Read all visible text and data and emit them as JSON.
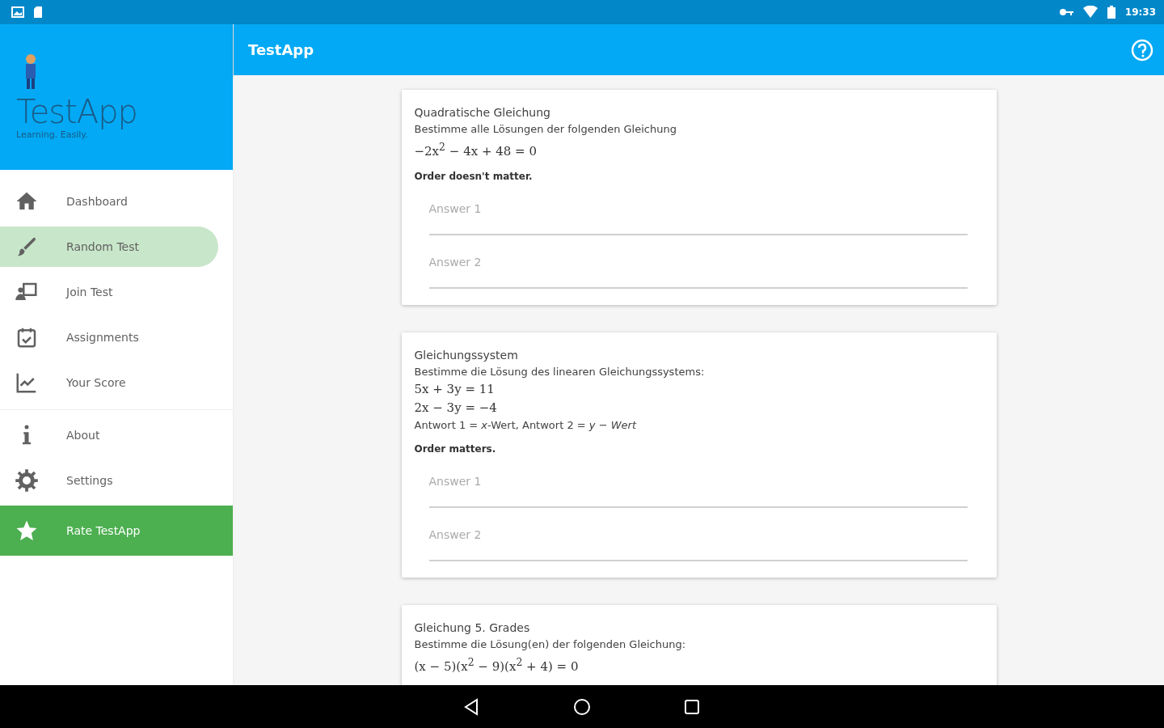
{
  "status_bar": {
    "time": "19:33"
  },
  "drawer": {
    "app_name": "TestApp",
    "tagline": "Learning. Easily.",
    "sections": [
      [
        {
          "label": "Dashboard",
          "kind": "nav",
          "selected": false
        },
        {
          "label": "Random Test",
          "kind": "nav",
          "selected": true
        },
        {
          "label": "Join Test",
          "kind": "nav",
          "selected": false
        },
        {
          "label": "Assignments",
          "kind": "nav",
          "selected": false
        },
        {
          "label": "Your Score",
          "kind": "nav",
          "selected": false
        }
      ],
      [
        {
          "label": "About",
          "kind": "nav",
          "selected": false
        },
        {
          "label": "Settings",
          "kind": "nav",
          "selected": false
        },
        {
          "label": "Rate TestApp",
          "kind": "action",
          "selected": false
        }
      ]
    ]
  },
  "app_bar": {
    "title": "TestApp"
  },
  "cards": [
    {
      "title": "Quadratische Gleichung",
      "instruction": "Bestimme alle Lösungen der folgenden Gleichung",
      "lines": [
        "−2x$^{2}$ − 4x + 48 = 0"
      ],
      "note": "Order doesn't matter.",
      "answers": [
        {
          "placeholder": "Answer 1"
        },
        {
          "placeholder": "Answer 2"
        }
      ]
    },
    {
      "title": "Gleichungssystem",
      "instruction": "Bestimme die Lösung des linearen Gleichungssystems:",
      "lines": [
        "5x + 3y = 11",
        "2x − 3y = −4"
      ],
      "hint": "Antwort 1 = *x*-Wert, Antwort 2 = *y* − *Wert*",
      "note": "Order matters.",
      "answers": [
        {
          "placeholder": "Answer 1"
        },
        {
          "placeholder": "Answer 2"
        }
      ]
    },
    {
      "title": "Gleichung 5. Grades",
      "instruction": "Bestimme die Lösung(en) der folgenden Gleichung:",
      "lines": [
        "(x − 5)(x$^{2}$ − 9)(x$^{2}$ + 4) = 0"
      ]
    }
  ]
}
